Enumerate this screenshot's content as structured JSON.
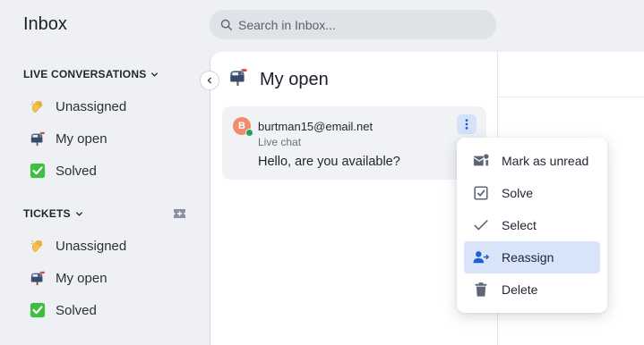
{
  "app": {
    "title": "Inbox"
  },
  "search": {
    "placeholder": "Search in Inbox..."
  },
  "sidebar": {
    "live_section": {
      "title": "LIVE CONVERSATIONS",
      "items": [
        {
          "emoji": "wave-icon",
          "label": "Unassigned"
        },
        {
          "emoji": "mailbox-icon",
          "label": "My open"
        },
        {
          "emoji": "check-mark-icon",
          "label": "Solved"
        }
      ]
    },
    "tickets_section": {
      "title": "TICKETS",
      "items": [
        {
          "emoji": "wave-icon",
          "label": "Unassigned"
        },
        {
          "emoji": "mailbox-icon",
          "label": "My open"
        },
        {
          "emoji": "check-mark-icon",
          "label": "Solved"
        }
      ]
    }
  },
  "list": {
    "title": "My open",
    "conversation": {
      "avatar_initial": "B",
      "email": "burtman15@email.net",
      "channel": "Live chat",
      "preview": "Hello, are you available?",
      "status": "online"
    }
  },
  "context_menu": {
    "items": [
      {
        "icon": "mark-unread-icon",
        "label": "Mark as unread"
      },
      {
        "icon": "solve-icon",
        "label": "Solve"
      },
      {
        "icon": "select-check-icon",
        "label": "Select"
      },
      {
        "icon": "reassign-icon",
        "label": "Reassign",
        "active": true
      },
      {
        "icon": "trash-icon",
        "label": "Delete"
      }
    ]
  },
  "colors": {
    "accent": "#1f5fd6",
    "active_bg": "#d8e4fa",
    "online": "#22a35a",
    "avatar": "#f08c6c"
  }
}
